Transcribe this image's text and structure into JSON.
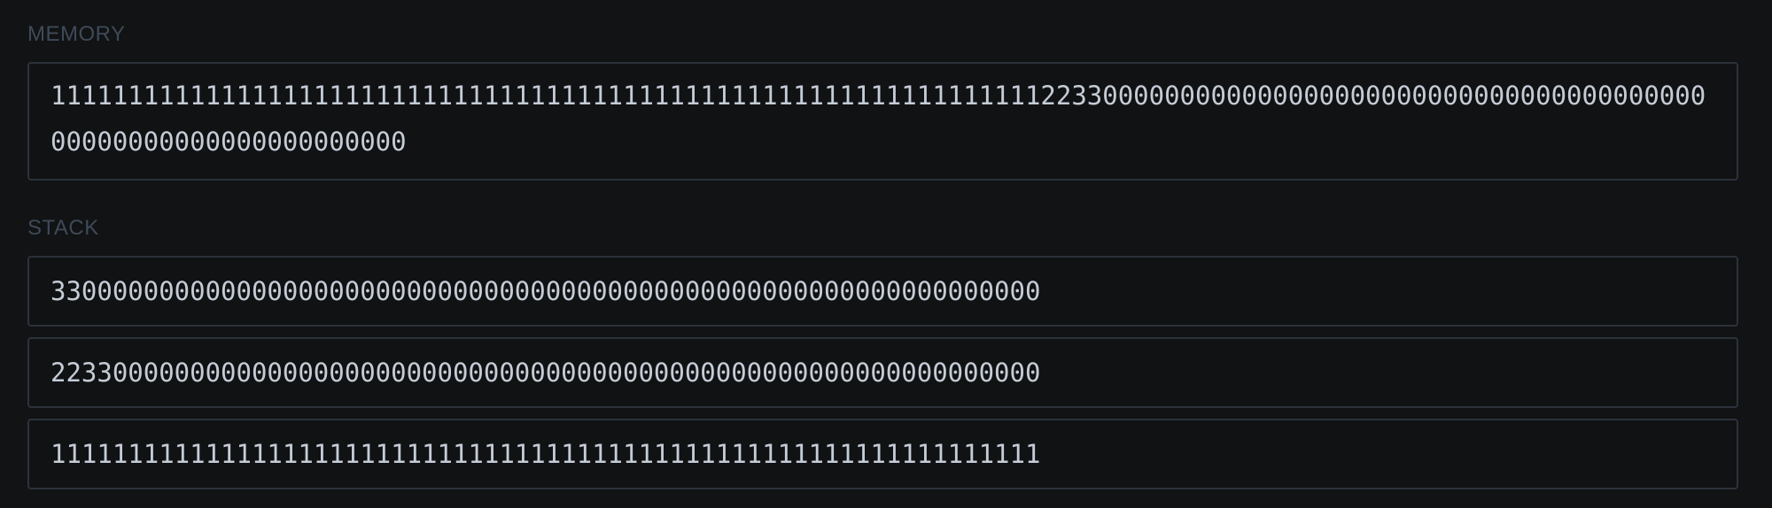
{
  "memory": {
    "label": "MEMORY",
    "value": "1111111111111111111111111111111111111111111111111111111111111111223300000000000000000000000000000000000000000000000000000000000000"
  },
  "stack": {
    "label": "STACK",
    "items": [
      "3300000000000000000000000000000000000000000000000000000000000000",
      "2233000000000000000000000000000000000000000000000000000000000000",
      "1111111111111111111111111111111111111111111111111111111111111111"
    ]
  }
}
